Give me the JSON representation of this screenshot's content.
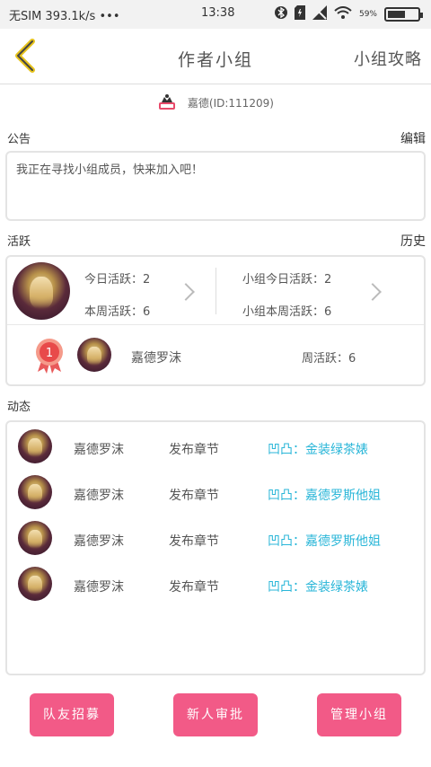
{
  "statusbar": {
    "carrier": "无SIM 393.1k/s",
    "dots": "•••",
    "time": "13:38",
    "battery": "59%",
    "battery_level": 0.59
  },
  "nav": {
    "title": "作者小组",
    "guide": "小组攻略"
  },
  "author": {
    "text": "嘉德(ID:111209)"
  },
  "notice": {
    "label": "公告",
    "edit": "编辑",
    "content": "我正在寻找小组成员，快来加入吧！"
  },
  "activity": {
    "label": "活跃",
    "history": "历史",
    "today_label": "今日活跃：",
    "today_value": "2",
    "week_label": "本周活跃：",
    "week_value": "6",
    "group_today_label": "小组今日活跃：",
    "group_today_value": "2",
    "group_week_label": "小组本周活跃：",
    "group_week_value": "6",
    "top_rank": "1",
    "top_name": "嘉德罗沫",
    "top_week_label": "周活跃：",
    "top_week_value": "6"
  },
  "feed": {
    "label": "动态",
    "items": [
      {
        "name": "嘉德罗沫",
        "action": "发布章节",
        "book": "凹凸：金装绿茶婊"
      },
      {
        "name": "嘉德罗沫",
        "action": "发布章节",
        "book": "凹凸：嘉德罗斯他姐"
      },
      {
        "name": "嘉德罗沫",
        "action": "发布章节",
        "book": "凹凸：嘉德罗斯他姐"
      },
      {
        "name": "嘉德罗沫",
        "action": "发布章节",
        "book": "凹凸：金装绿茶婊"
      }
    ]
  },
  "buttons": {
    "recruit": "队友招募",
    "approve": "新人审批",
    "manage": "管理小组"
  },
  "colors": {
    "accent": "#f25a87",
    "link": "#29b6d8",
    "back_arrow": "#e6c21a"
  }
}
